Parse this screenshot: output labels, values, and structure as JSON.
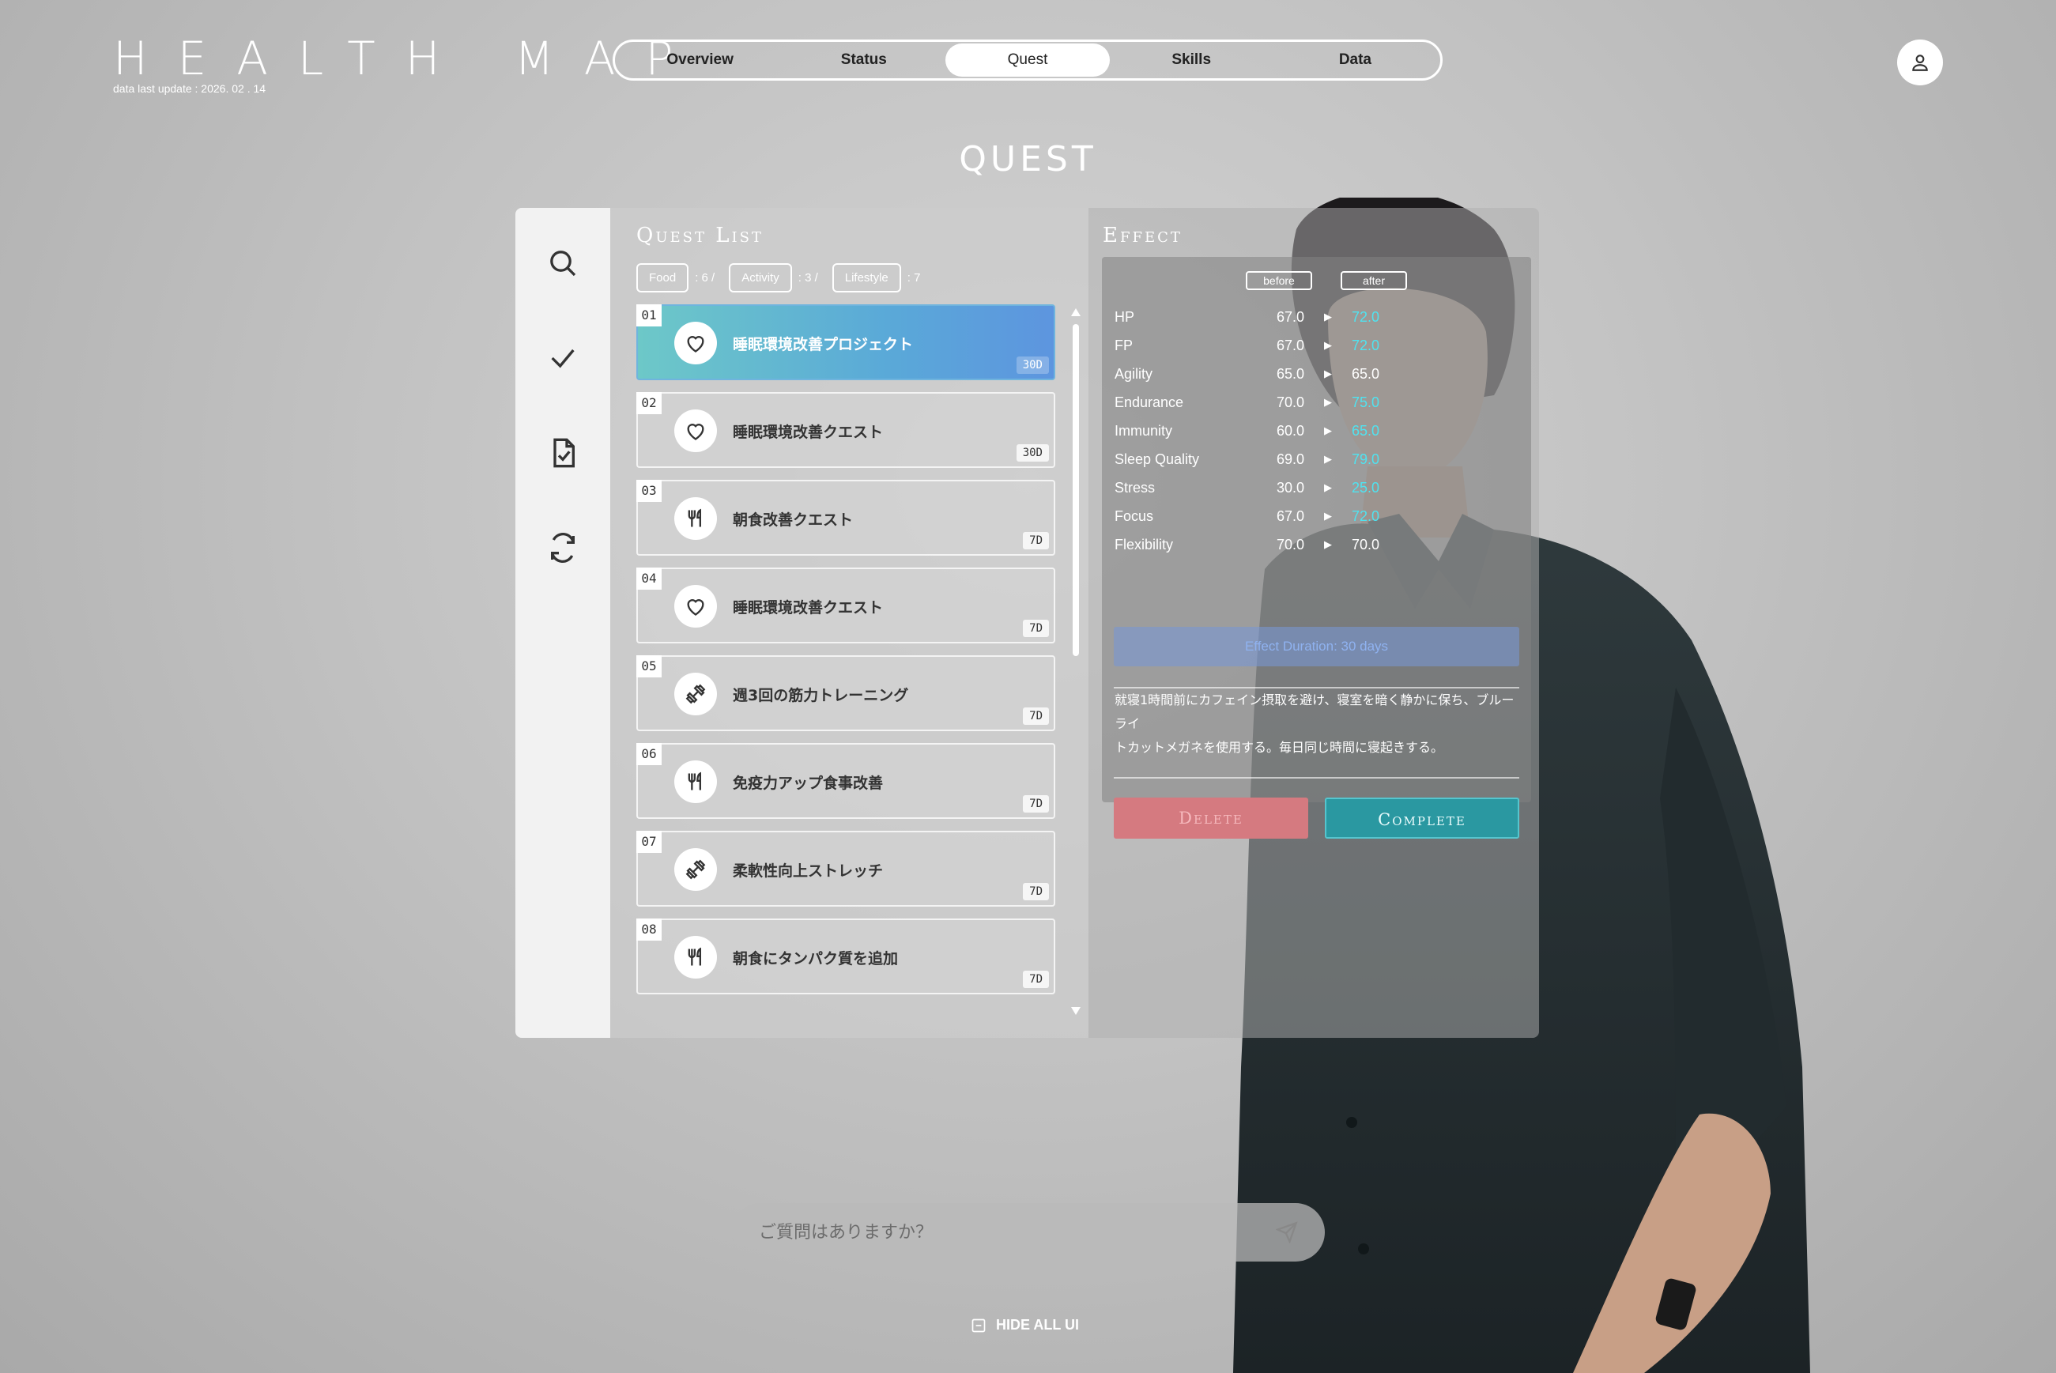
{
  "header": {
    "logo": "HEALTH MAP",
    "last_update": "data last update : 2026. 02 . 14",
    "nav_tabs": [
      "Overview",
      "Status",
      "Quest",
      "Skills",
      "Data"
    ],
    "active_tab": "Quest",
    "user_icon": "user-icon"
  },
  "page_title": "QUEST",
  "sidebar": {
    "icons": [
      "search-icon",
      "check-icon",
      "document-check-icon",
      "refresh-icon"
    ]
  },
  "quest_list": {
    "title": "Quest List",
    "filters": [
      {
        "label": "Food",
        "count": ": 6  /"
      },
      {
        "label": "Activity",
        "count": ": 3  /"
      },
      {
        "label": "Lifestyle",
        "count": ": 7"
      }
    ],
    "items": [
      {
        "num": "01",
        "icon": "heart-icon",
        "title": "睡眠環境改善プロジェクト",
        "days": "30D"
      },
      {
        "num": "02",
        "icon": "heart-icon",
        "title": "睡眠環境改善クエスト",
        "days": "30D"
      },
      {
        "num": "03",
        "icon": "fork-knife-icon",
        "title": "朝食改善クエスト",
        "days": "7D"
      },
      {
        "num": "04",
        "icon": "heart-icon",
        "title": "睡眠環境改善クエスト",
        "days": "7D"
      },
      {
        "num": "05",
        "icon": "dumbbell-icon",
        "title": "週3回の筋力トレーニング",
        "days": "7D"
      },
      {
        "num": "06",
        "icon": "fork-knife-icon",
        "title": "免疫力アップ食事改善",
        "days": "7D"
      },
      {
        "num": "07",
        "icon": "dumbbell-icon",
        "title": "柔軟性向上ストレッチ",
        "days": "7D"
      },
      {
        "num": "08",
        "icon": "fork-knife-icon",
        "title": "朝食にタンパク質を追加",
        "days": "7D"
      }
    ],
    "selected": "01"
  },
  "effect": {
    "title": "Effect",
    "before_label": "before",
    "after_label": "after",
    "stats": [
      {
        "name": "HP",
        "before": "67.0",
        "after": "72.0",
        "changed": true
      },
      {
        "name": "FP",
        "before": "67.0",
        "after": "72.0",
        "changed": true
      },
      {
        "name": "Agility",
        "before": "65.0",
        "after": "65.0",
        "changed": false
      },
      {
        "name": "Endurance",
        "before": "70.0",
        "after": "75.0",
        "changed": true
      },
      {
        "name": "Immunity",
        "before": "60.0",
        "after": "65.0",
        "changed": true
      },
      {
        "name": "Sleep Quality",
        "before": "69.0",
        "after": "79.0",
        "changed": true
      },
      {
        "name": "Stress",
        "before": "30.0",
        "after": "25.0",
        "changed": true
      },
      {
        "name": "Focus",
        "before": "67.0",
        "after": "72.0",
        "changed": true
      },
      {
        "name": "Flexibility",
        "before": "70.0",
        "after": "70.0",
        "changed": false
      }
    ],
    "duration": "Effect Duration: 30 days",
    "description_line1": "就寝1時間前にカフェイン摂取を避け、寝室を暗く静かに保ち、ブルーライ",
    "description_line2": "トカットメガネを使用する。毎日同じ時間に寝起きする。",
    "delete_label": "Delete",
    "complete_label": "Complete"
  },
  "chat": {
    "placeholder": "ご質問はありますか？",
    "send_icon": "send-icon"
  },
  "hide_ui_label": "HIDE ALL UI",
  "colors": {
    "accent_cyan": "#4fe3f0",
    "active_gradient_start": "#6dc8c8",
    "active_gradient_end": "#5d95df",
    "delete_red": "#d57a80",
    "complete_teal": "#2a98a1"
  }
}
